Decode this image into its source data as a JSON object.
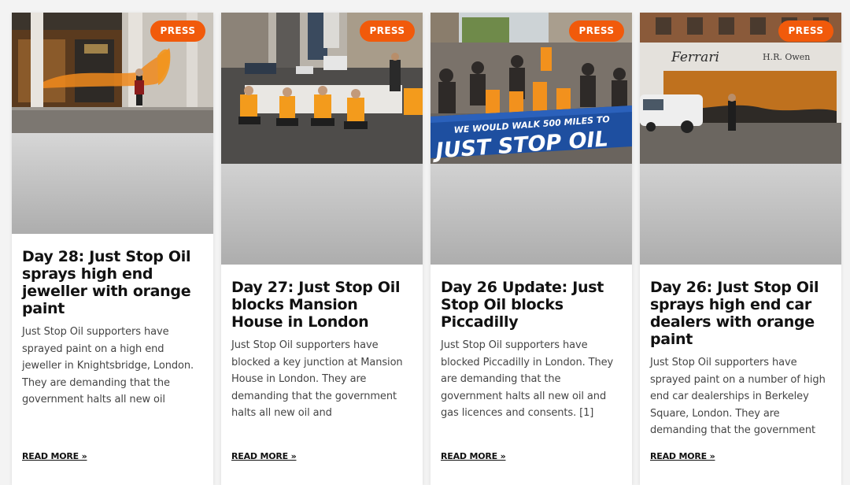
{
  "cards": [
    {
      "badge": "PRESS",
      "title": "Day 28: Just Stop Oil sprays high end jeweller with orange paint",
      "excerpt": "Just Stop Oil supporters have sprayed paint on a high end jeweller in Knightsbridge, London. They are demanding that the government halts all new oil",
      "read_more": "READ MORE »",
      "image": "photo of a jeweller shopfront sprayed with orange paint"
    },
    {
      "badge": "PRESS",
      "title": "Day 27: Just Stop Oil blocks Mansion House in London",
      "excerpt": "Just Stop Oil supporters have blocked a key junction at Mansion House in London. They are demanding that the government halts all new oil and",
      "read_more": "READ MORE »",
      "image": "photo of protesters in orange vests sitting on a road"
    },
    {
      "badge": "PRESS",
      "title": "Day 26 Update: Just Stop Oil blocks Piccadilly",
      "excerpt": "Just Stop Oil supporters have blocked Piccadilly in London. They are demanding that the government halts all new oil and gas licences and consents. [1]",
      "read_more": "READ MORE »",
      "image": "photo of protesters holding a Just Stop Oil banner",
      "banner_text_1": "WE WOULD WALK 500 MILES TO",
      "banner_text_2": "JUST STOP OIL"
    },
    {
      "badge": "PRESS",
      "title": "Day 26: Just Stop Oil sprays high end car dealers with orange paint",
      "excerpt": "Just Stop Oil supporters have sprayed paint on a number of high end car dealerships in Berkeley Square, London. They are demanding that the government",
      "read_more": "READ MORE »",
      "image": "photo of a Ferrari dealership sprayed with orange paint",
      "sign_text_1": "Ferrari",
      "sign_text_2": "H.R. Owen"
    }
  ],
  "colors": {
    "badge": "#f15a0b",
    "title": "#111111",
    "body_text": "#444444",
    "background": "#f3f3f3"
  }
}
